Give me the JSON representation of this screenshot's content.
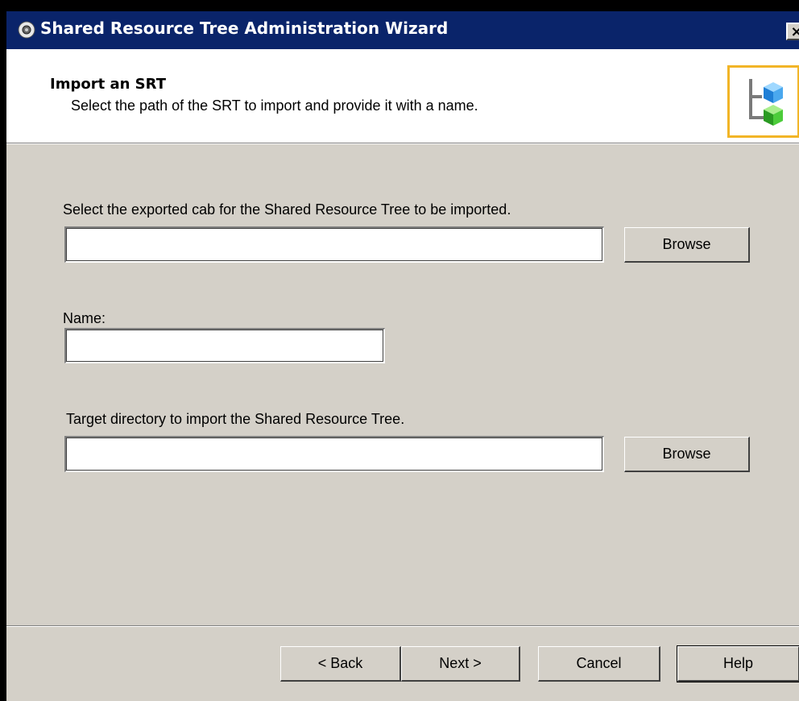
{
  "window": {
    "title": "Shared Resource Tree Administration Wizard",
    "close_label": "×"
  },
  "header": {
    "title": "Import an SRT",
    "subtitle": "Select the path of the SRT to import and provide it with a name.",
    "icon": "shared-resource-tree-icon"
  },
  "form": {
    "cab_label": "Select the exported cab for the Shared Resource Tree to be imported.",
    "cab_value": "",
    "cab_browse": "Browse",
    "name_label": "Name:",
    "name_value": "",
    "target_label": "Target directory to import the Shared Resource Tree.",
    "target_value": "",
    "target_browse": "Browse"
  },
  "footer": {
    "back": "< Back",
    "next": "Next >",
    "cancel": "Cancel",
    "help": "Help"
  },
  "colors": {
    "title_bar": "#0a246a",
    "dialog_bg": "#d4d0c8",
    "icon_border": "#f2b527"
  }
}
